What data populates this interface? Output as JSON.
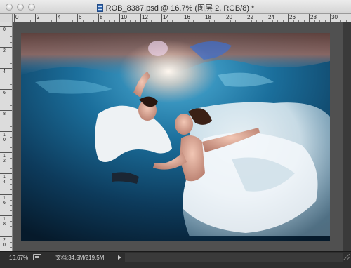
{
  "window": {
    "title": "ROB_8387.psd @ 16.7% (图层 2, RGB/8) *"
  },
  "rulers": {
    "horizontal_labels": [
      "0",
      "2",
      "4",
      "6",
      "8",
      "10",
      "12",
      "14",
      "16",
      "18",
      "20",
      "22",
      "24",
      "26",
      "28",
      "30"
    ],
    "vertical_labels": [
      [
        "0"
      ],
      [
        "2"
      ],
      [
        "4"
      ],
      [
        "6"
      ],
      [
        "8"
      ],
      [
        "1",
        "0"
      ],
      [
        "1",
        "2"
      ],
      [
        "1",
        "4"
      ],
      [
        "1",
        "6"
      ],
      [
        "1",
        "8"
      ],
      [
        "2",
        "0"
      ]
    ]
  },
  "status": {
    "zoom": "16.67%",
    "doc_info": "文档:34.5M/219.5M"
  },
  "icons": {
    "close": "close-icon",
    "minimize": "minimize-icon",
    "zoom": "zoom-icon",
    "document": "psd-document-icon",
    "status": "status-info-icon",
    "arrow": "play-arrow-icon"
  },
  "colors": {
    "pasteboard": "#505050",
    "window_chrome": "#2b2b2b",
    "titlebar": "#e0e0e0"
  }
}
